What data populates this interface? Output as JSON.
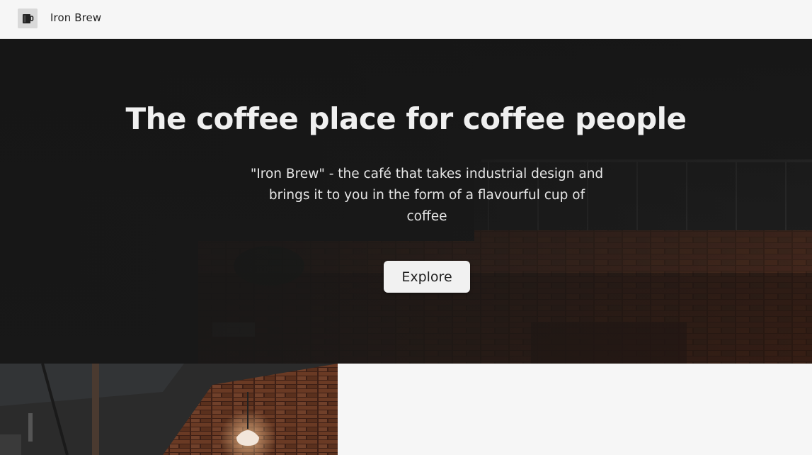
{
  "navbar": {
    "logo_icon": "coffee-cup-icon",
    "brand": "Iron Brew"
  },
  "hero": {
    "title": "The coffee place for coffee people",
    "subtitle": "\"Iron Brew\" - the café that takes industrial design and brings it to you in the form of a flavourful cup of coffee",
    "explore_label": "Explore"
  },
  "colors": {
    "navbar_bg": "#f6f6f6",
    "hero_overlay": "#1c1c1c",
    "brick": "#5a2e1c",
    "button_bg": "#f1f1f1"
  }
}
